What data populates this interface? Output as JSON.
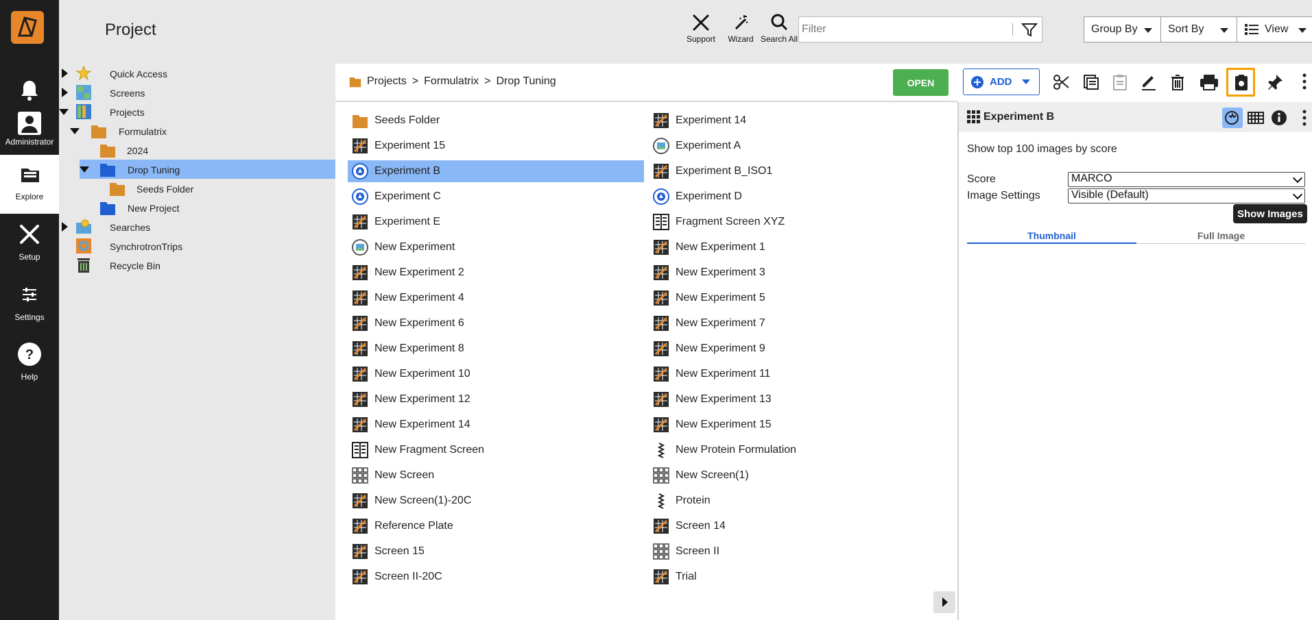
{
  "app": {
    "title": "Project"
  },
  "rail": {
    "items": [
      {
        "label": "",
        "name": "notifications"
      },
      {
        "label": "Administrator",
        "name": "administrator"
      },
      {
        "label": "Explore",
        "name": "explore"
      },
      {
        "label": "Setup",
        "name": "setup"
      },
      {
        "label": "Settings",
        "name": "settings"
      },
      {
        "label": "Help",
        "name": "help"
      }
    ]
  },
  "header": {
    "support_label": "Support",
    "wizard_label": "Wizard",
    "search_all_label": "Search All",
    "filter_placeholder": "Filter",
    "group_by_label": "Group By",
    "sort_by_label": "Sort By",
    "view_label": "View"
  },
  "tree": {
    "items": [
      {
        "label": "Quick Access",
        "icon": "star-icon"
      },
      {
        "label": "Screens",
        "icon": "screens-icon"
      },
      {
        "label": "Projects",
        "icon": "projects-icon"
      },
      {
        "label": "Formulatrix",
        "icon": "folder-icon"
      },
      {
        "label": "2024",
        "icon": "folder-icon"
      },
      {
        "label": "Drop Tuning",
        "icon": "folder-icon"
      },
      {
        "label": "Seeds Folder",
        "icon": "folder-icon"
      },
      {
        "label": "New Project",
        "icon": "folder-icon"
      },
      {
        "label": "Searches",
        "icon": "search-folder-icon"
      },
      {
        "label": "SynchrotronTrips",
        "icon": "synchrotron-icon"
      },
      {
        "label": "Recycle Bin",
        "icon": "recycle-bin-icon"
      }
    ]
  },
  "breadcrumb": {
    "items": [
      "Projects",
      "Formulatrix",
      "Drop Tuning"
    ],
    "separator": ">"
  },
  "toolbar": {
    "open_label": "OPEN",
    "add_label": "ADD"
  },
  "list": {
    "left": [
      {
        "label": "Seeds Folder",
        "icon": "folder-icon"
      },
      {
        "label": "Experiment 15",
        "icon": "experiment-icon"
      },
      {
        "label": "Experiment B",
        "icon": "experiment-imaging-icon",
        "selected": true
      },
      {
        "label": "Experiment C",
        "icon": "experiment-imaging-icon"
      },
      {
        "label": "Experiment E",
        "icon": "experiment-icon"
      },
      {
        "label": "New Experiment",
        "icon": "experiment-image-icon"
      },
      {
        "label": "New Experiment 2",
        "icon": "experiment-icon"
      },
      {
        "label": "New Experiment 4",
        "icon": "experiment-icon"
      },
      {
        "label": "New Experiment 6",
        "icon": "experiment-icon"
      },
      {
        "label": "New Experiment 8",
        "icon": "experiment-icon"
      },
      {
        "label": "New Experiment 10",
        "icon": "experiment-icon"
      },
      {
        "label": "New Experiment 12",
        "icon": "experiment-icon"
      },
      {
        "label": "New Experiment 14",
        "icon": "experiment-icon"
      },
      {
        "label": "New Fragment Screen",
        "icon": "fragment-screen-icon"
      },
      {
        "label": "New Screen",
        "icon": "screen-icon"
      },
      {
        "label": "New Screen(1)-20C",
        "icon": "experiment-icon"
      },
      {
        "label": "Reference Plate",
        "icon": "experiment-icon"
      },
      {
        "label": "Screen 15",
        "icon": "experiment-icon"
      },
      {
        "label": "Screen II-20C",
        "icon": "experiment-icon"
      }
    ],
    "right": [
      {
        "label": "Experiment 14",
        "icon": "experiment-icon"
      },
      {
        "label": "Experiment A",
        "icon": "experiment-image-icon"
      },
      {
        "label": "Experiment B_ISO1",
        "icon": "experiment-icon"
      },
      {
        "label": "Experiment D",
        "icon": "experiment-imaging-icon"
      },
      {
        "label": "Fragment Screen XYZ",
        "icon": "fragment-screen-icon"
      },
      {
        "label": "New Experiment 1",
        "icon": "experiment-icon"
      },
      {
        "label": "New Experiment 3",
        "icon": "experiment-icon"
      },
      {
        "label": "New Experiment 5",
        "icon": "experiment-icon"
      },
      {
        "label": "New Experiment 7",
        "icon": "experiment-icon"
      },
      {
        "label": "New Experiment 9",
        "icon": "experiment-icon"
      },
      {
        "label": "New Experiment 11",
        "icon": "experiment-icon"
      },
      {
        "label": "New Experiment 13",
        "icon": "experiment-icon"
      },
      {
        "label": "New Experiment 15",
        "icon": "experiment-icon"
      },
      {
        "label": "New Protein Formulation",
        "icon": "protein-icon"
      },
      {
        "label": "New Screen(1)",
        "icon": "screen-icon"
      },
      {
        "label": "Protein",
        "icon": "protein-icon"
      },
      {
        "label": "Screen 14",
        "icon": "experiment-icon"
      },
      {
        "label": "Screen II",
        "icon": "screen-icon"
      },
      {
        "label": "Trial",
        "icon": "experiment-icon"
      }
    ]
  },
  "details": {
    "title": "Experiment B",
    "show_top_text": "Show top 100 images by score",
    "score_label": "Score",
    "score_value": "MARCO",
    "image_settings_label": "Image Settings",
    "image_settings_value": "Visible (Default)",
    "tooltip": "Show Images",
    "tabs": [
      "Thumbnail",
      "Full Image"
    ]
  },
  "colors": {
    "accent": "#1f5fd1",
    "selection": "#8ab8f6",
    "open_button": "#4caf50",
    "brand": "#e8862a",
    "highlight": "#f5a000"
  }
}
